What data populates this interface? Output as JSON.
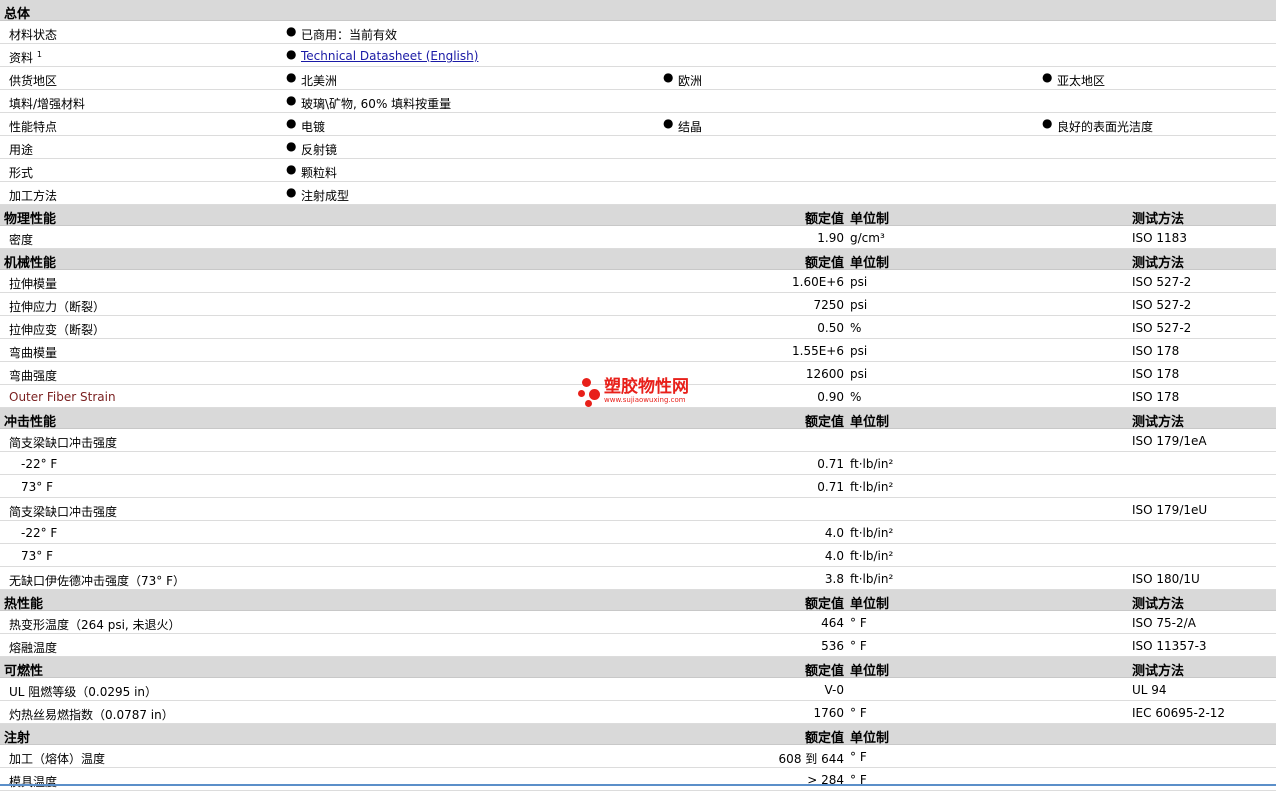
{
  "general": {
    "title": "总体",
    "status_label": "材料状态",
    "status_value": "已商用：当前有效",
    "docs_label": "资料",
    "docs_sup": "1",
    "docs_link": "Technical Datasheet (English)",
    "supply_label": "供货地区",
    "supply": [
      "北美洲",
      "欧洲",
      "亚太地区"
    ],
    "filler_label": "填料/增强材料",
    "filler_value": "玻璃\\矿物, 60% 填料按重量",
    "features_label": "性能特点",
    "features": [
      "电镀",
      "结晶",
      "良好的表面光洁度"
    ],
    "uses_label": "用途",
    "uses_value": "反射镜",
    "form_label": "形式",
    "form_value": "颗粒料",
    "process_label": "加工方法",
    "process_value": "注射成型"
  },
  "col_headers": {
    "value": "额定值",
    "unit": "单位制",
    "method": "测试方法"
  },
  "physical": {
    "title": "物理性能",
    "rows": [
      {
        "label": "密度",
        "value": "1.90",
        "unit": "g/cm³",
        "method": "ISO 1183"
      }
    ]
  },
  "mechanical": {
    "title": "机械性能",
    "rows": [
      {
        "label": "拉伸模量",
        "value": "1.60E+6",
        "unit": "psi",
        "method": "ISO 527-2"
      },
      {
        "label": "拉伸应力（断裂）",
        "value": "7250",
        "unit": "psi",
        "method": "ISO 527-2"
      },
      {
        "label": "拉伸应变（断裂）",
        "value": "0.50",
        "unit": "%",
        "method": "ISO 527-2"
      },
      {
        "label": "弯曲模量",
        "value": "1.55E+6",
        "unit": "psi",
        "method": "ISO 178"
      },
      {
        "label": "弯曲强度",
        "value": "12600",
        "unit": "psi",
        "method": "ISO 178"
      },
      {
        "label": "Outer Fiber Strain",
        "value": "0.90",
        "unit": "%",
        "method": "ISO 178"
      }
    ]
  },
  "impact": {
    "title": "冲击性能",
    "g1_label": "简支梁缺口冲击强度",
    "g1_method": "ISO 179/1eA",
    "g1_rows": [
      {
        "label": "-22° F",
        "value": "0.71",
        "unit": "ft·lb/in²"
      },
      {
        "label": "73° F",
        "value": "0.71",
        "unit": "ft·lb/in²"
      }
    ],
    "g2_label": "简支梁缺口冲击强度",
    "g2_method": "ISO 179/1eU",
    "g2_rows": [
      {
        "label": "-22° F",
        "value": "4.0",
        "unit": "ft·lb/in²"
      },
      {
        "label": "73° F",
        "value": "4.0",
        "unit": "ft·lb/in²"
      }
    ],
    "izod": {
      "label": "无缺口伊佐德冲击强度（73° F）",
      "value": "3.8",
      "unit": "ft·lb/in²",
      "method": "ISO 180/1U"
    }
  },
  "thermal": {
    "title": "热性能",
    "rows": [
      {
        "label": "热变形温度（264 psi, 未退火）",
        "value": "464",
        "unit": "° F",
        "method": "ISO 75-2/A"
      },
      {
        "label": "熔融温度",
        "value": "536",
        "unit": "° F",
        "method": "ISO 11357-3"
      }
    ]
  },
  "flammability": {
    "title": "可燃性",
    "rows": [
      {
        "label": "UL 阻燃等级（0.0295 in）",
        "value": "V-0",
        "unit": "",
        "method": "UL 94"
      },
      {
        "label": "灼热丝易燃指数（0.0787 in）",
        "value": "1760",
        "unit": "° F",
        "method": "IEC 60695-2-12"
      }
    ]
  },
  "injection": {
    "title": "注射",
    "rows": [
      {
        "label": "加工（熔体）温度",
        "value": "608 到 644",
        "unit": "° F"
      },
      {
        "label": "模具温度",
        "value": "> 284",
        "unit": "° F"
      }
    ]
  },
  "watermark": {
    "name": "塑胶物性网",
    "url": "www.sujiaowuxing.com",
    "color": "#e8201a"
  }
}
